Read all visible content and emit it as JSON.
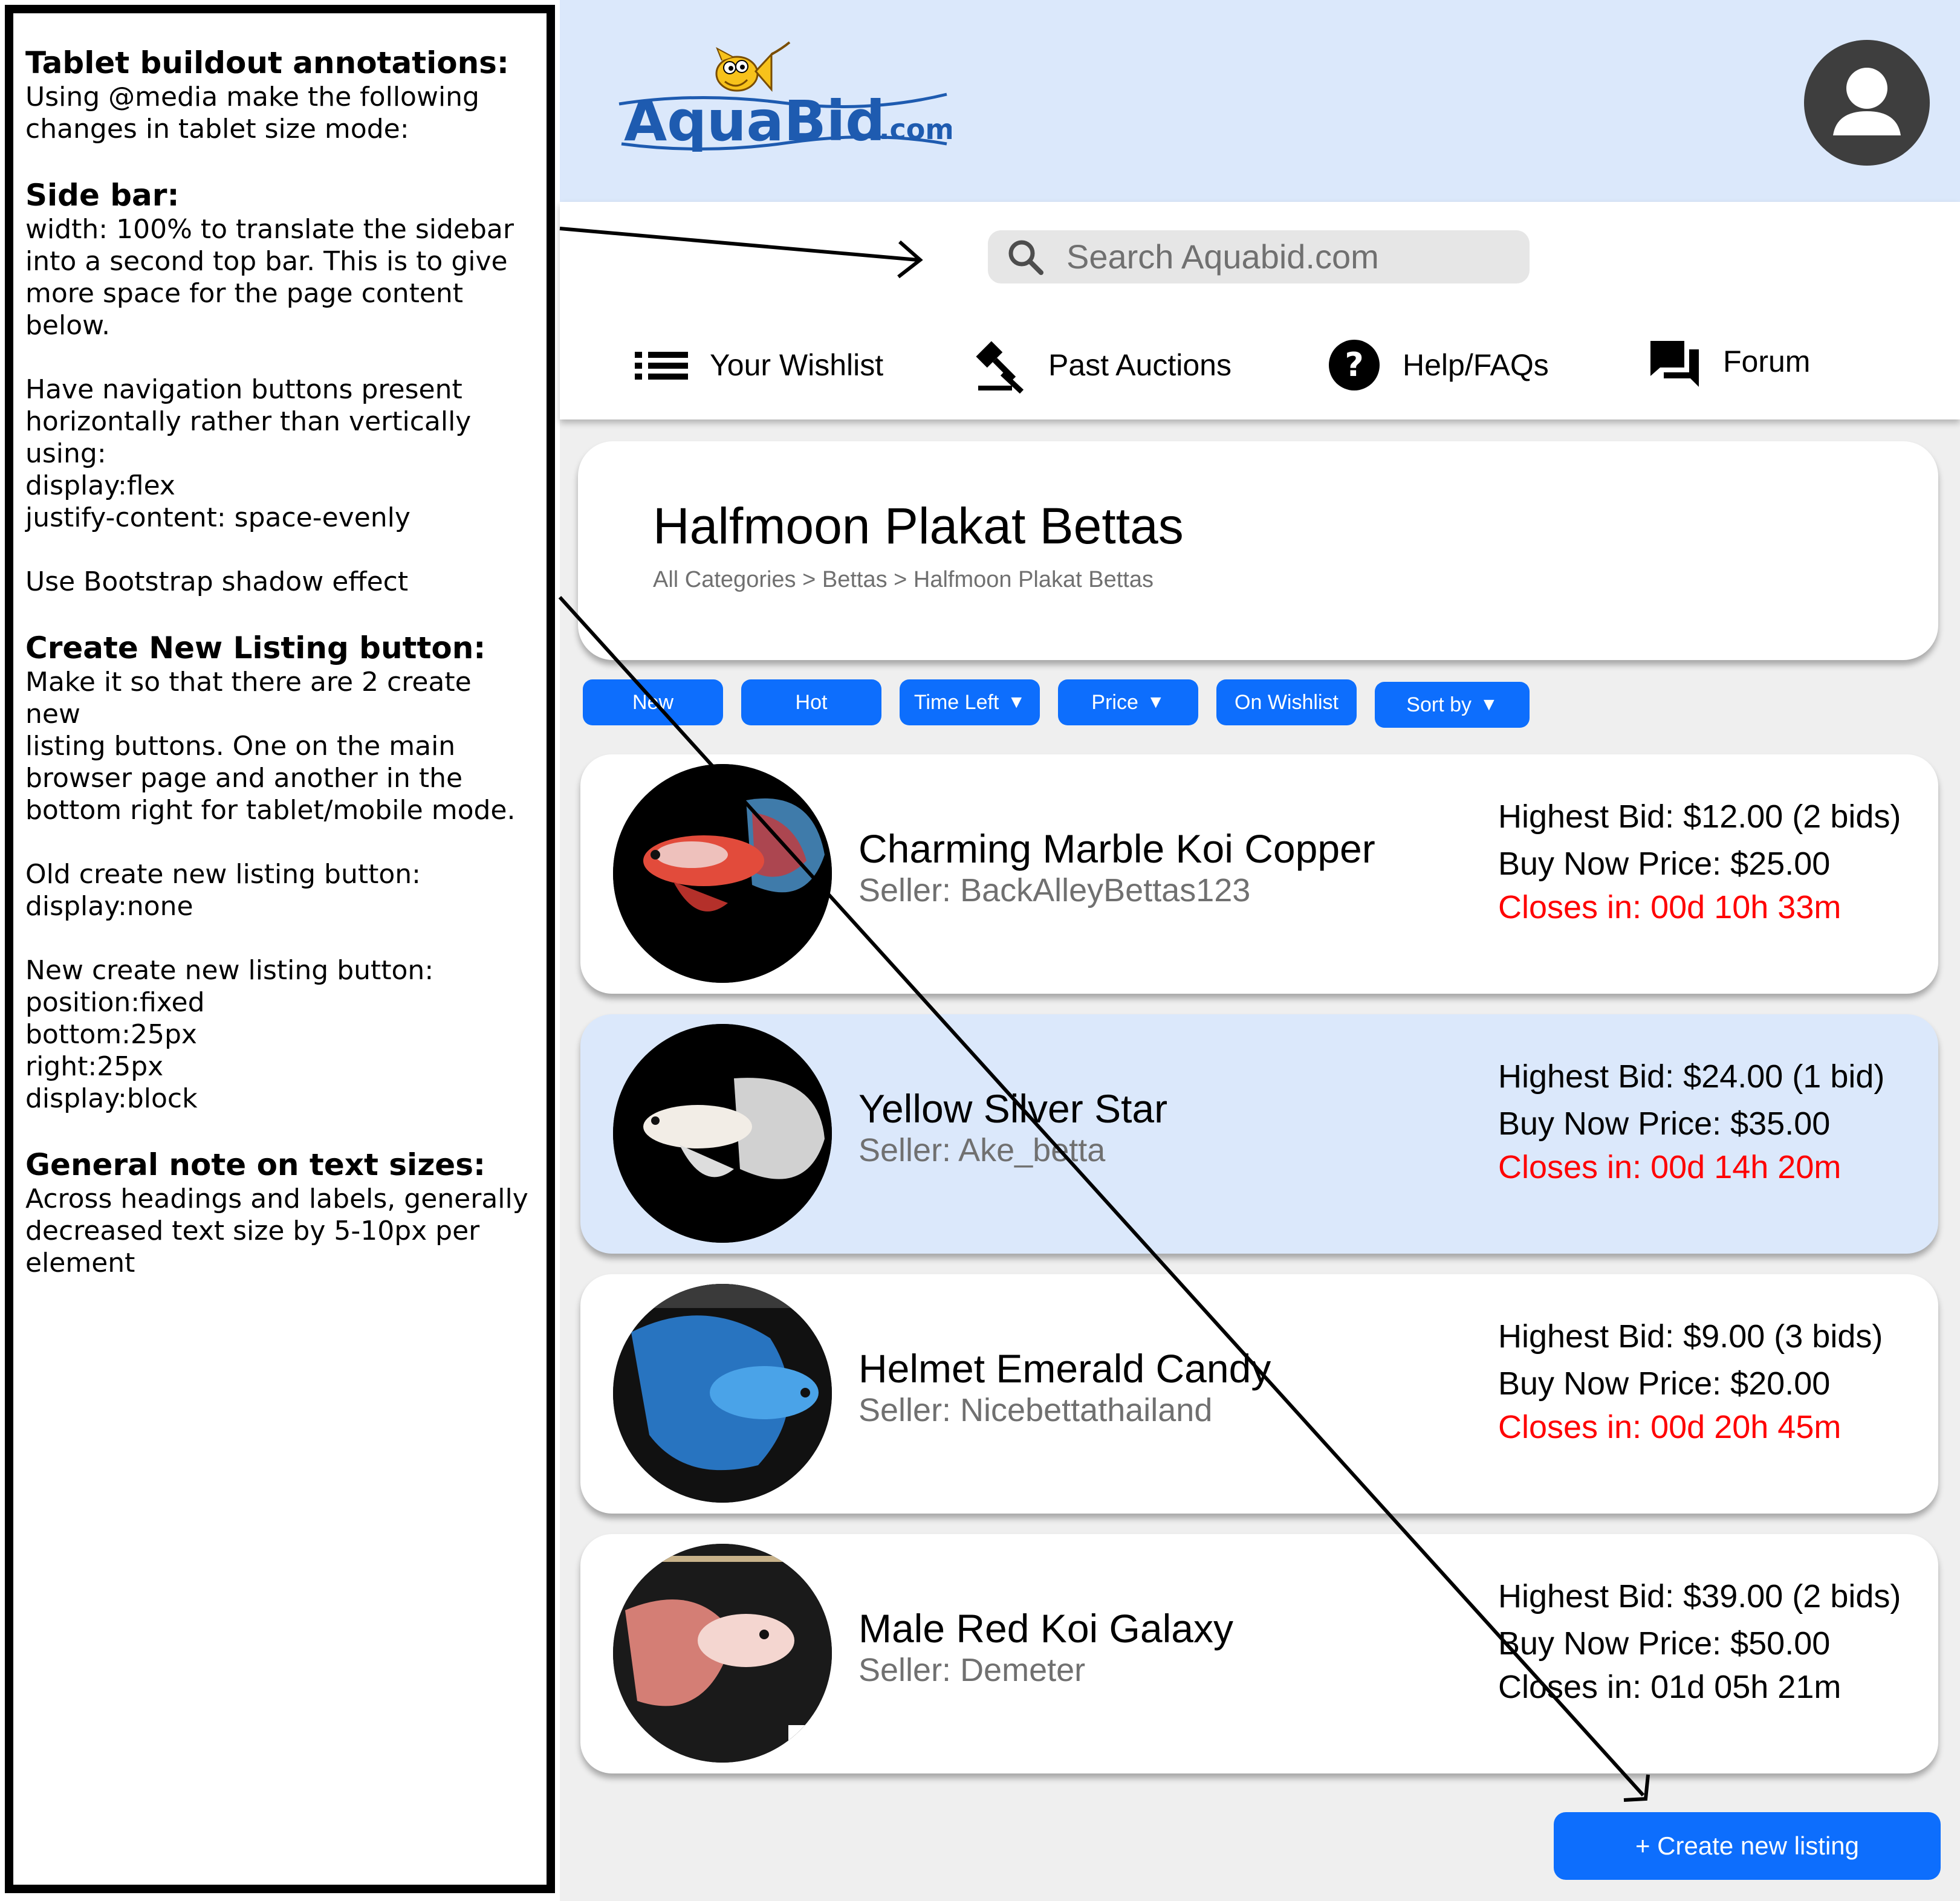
{
  "annotations": {
    "title": "Tablet buildout annotations:",
    "intro": [
      "Using @media make the following",
      "changes in tablet size mode:"
    ],
    "sidebar_heading": "Side bar:",
    "sidebar_lines": [
      "width: 100% to translate the sidebar",
      "into a second top bar. This is to give",
      "more space for the page content below."
    ],
    "nav_lines": [
      "Have navigation buttons present",
      "horizontally rather than vertically using:",
      "display:flex",
      "justify-content: space-evenly"
    ],
    "shadow_line": "Use Bootstrap shadow effect",
    "create_heading": "Create New Listing button:",
    "create_lines": [
      "Make it so that there are 2 create new",
      "listing buttons. One on the main",
      "browser page and another in the",
      "bottom right for tablet/mobile mode."
    ],
    "old_lines": [
      "Old create new listing button:",
      "display:none"
    ],
    "new_lines": [
      "New create new listing button:",
      "position:fixed",
      "bottom:25px",
      "right:25px",
      "display:block"
    ],
    "text_heading": "General note on text sizes:",
    "text_lines": [
      "Across headings and labels, generally",
      "decreased text size by 5-10px per",
      "element"
    ]
  },
  "logo": {
    "text_main": "AquaBid",
    "text_suffix": ".com"
  },
  "search": {
    "placeholder": "Search Aquabid.com"
  },
  "nav": [
    {
      "label": "Your Wishlist",
      "icon": "list-icon"
    },
    {
      "label": "Past Auctions",
      "icon": "gavel-icon"
    },
    {
      "label": "Help/FAQs",
      "icon": "help-icon"
    },
    {
      "label": "Forum",
      "icon": "forum-icon"
    }
  ],
  "page": {
    "title": "Halfmoon Plakat Bettas",
    "breadcrumb": "All Categories > Bettas > Halfmoon Plakat Bettas"
  },
  "filters": [
    "New",
    "Hot",
    "Time Left",
    "Price",
    "On Wishlist",
    "Sort by"
  ],
  "listings": [
    {
      "name": "Charming Marble Koi Copper",
      "seller": "Seller: BackAlleyBettas123",
      "highest_bid": "Highest Bid: $12.00 (2 bids)",
      "buy_now": "Buy Now Price: $25.00",
      "closes": "Closes in: 00d 10h 33m"
    },
    {
      "name": "Yellow Silver Star",
      "seller": "Seller: Ake_betta",
      "highest_bid": "Highest Bid: $24.00 (1 bid)",
      "buy_now": "Buy Now Price: $35.00",
      "closes": "Closes in: 00d 14h 20m"
    },
    {
      "name": "Helmet Emerald Candy",
      "seller": "Seller: Nicebettathailand",
      "highest_bid": "Highest Bid: $9.00 (3 bids)",
      "buy_now": "Buy Now Price: $20.00",
      "closes": "Closes in: 00d 20h 45m"
    },
    {
      "name": "Male Red Koi Galaxy",
      "seller": "Seller: Demeter",
      "highest_bid": "Highest Bid: $39.00 (2 bids)",
      "buy_now": "Buy Now Price: $50.00",
      "closes": "Closes in: 01d 05h 21m"
    }
  ],
  "create_button": "+ Create new listing",
  "colors": {
    "accent": "#0d6efd",
    "topbar": "#dbe8fb",
    "closing": "#ff0000",
    "background": "#efefef"
  }
}
